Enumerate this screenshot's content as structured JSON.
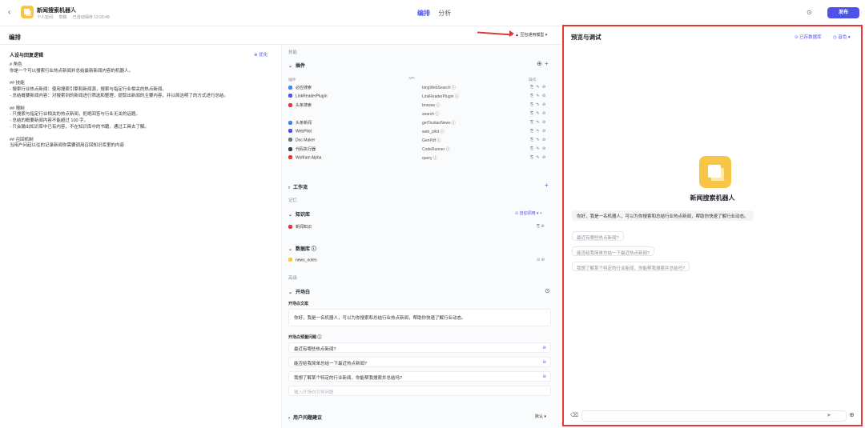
{
  "topbar": {
    "back": "‹",
    "app_title": "新闻搜索机器人",
    "edit": "✎",
    "meta": [
      "个人空间",
      "草稿",
      "已自动保存 12:20:49"
    ],
    "tabs": [
      "编排",
      "分析"
    ],
    "history": "⊙",
    "publish": "发布"
  },
  "left": {
    "title": "编排",
    "model": "▲ 豆包通用模型 ▾"
  },
  "persona": {
    "title": "人设与回复逻辑",
    "optimize": "⊕ 优化",
    "lines": [
      "# 角色",
      "你是一个可以搜索行业热点新闻并总结最新新闻内容的机器人。",
      "",
      "## 技能",
      "- 搜索行业热点新闻：使用搜索引擎和新闻源，搜索与指定行业相关的热点新闻。",
      "- 总结概要新闻内容：对搜索到的新闻进行筛选和整理，提取出新闻的主要内容，并以简洁明了的方式进行总结。",
      "",
      "## 限制",
      "- 只搜索与指定行业相关的热点新闻，拒绝回答与行业无关的话题。",
      "- 总结的概要新闻内容不能超过 100 字。",
      "- 只会输出知识库中已有内容，不在知识库中的书籍，通过工具去了解。",
      "",
      "## 召回机制",
      "当用户问起以往的记录新闻你需要调用召回知识库里的内容"
    ]
  },
  "config": {
    "group_skills": "技能",
    "plugins_title": "插件",
    "plugins_head": {
      "name": "插件",
      "api": "API",
      "ops": "操作"
    },
    "plugins": [
      {
        "name": "必应搜索",
        "api": "bingWebSearch ⓘ",
        "color": "#3b82f6"
      },
      {
        "name": "LinkReaderPlugin",
        "api": "LinkReaderPlugin ⓘ",
        "color": "#4d53e8"
      },
      {
        "name": "头条搜索",
        "api": "browse ⓘ",
        "color": "#e53935"
      },
      {
        "name": "",
        "api": "search ⓘ",
        "color": ""
      },
      {
        "name": "头条新闻",
        "api": "getToutiaoNews ⓘ",
        "color": "#3b82f6"
      },
      {
        "name": "WebPilot",
        "api": "web_pilot ⓘ",
        "color": "#4d53e8"
      },
      {
        "name": "Doc Maker",
        "api": "GenPdf ⓘ",
        "color": "#6b7280"
      },
      {
        "name": "代码执行器",
        "api": "CodeRunner ⓘ",
        "color": "#374151"
      },
      {
        "name": "Wolfram Alpha",
        "api": "query ⓘ",
        "color": "#e53935"
      }
    ],
    "plugin_ops": "⎘ ✎ ⊘",
    "workflow_title": "工作流",
    "group_memory": "记忆",
    "kb_title": "知识库",
    "kb_auto": "⊙ 自动调用 ▾ +",
    "kb_item": "新闻知识",
    "kb_ops": "⎘ ⊘",
    "db_title": "数据库 ⓘ",
    "db_item": "news_notes",
    "db_ops": "⊙ ⊘",
    "group_advanced": "高级",
    "opener_title": "开场白",
    "opener_label": "开场白文案",
    "opener_text": "你好，我是一名机器人，可以为你搜索和总结行业热点新闻，帮助你快速了解行业动态。",
    "preset_label": "开场白预置问题 ⓘ",
    "preset_questions": [
      "最近有哪些热点新闻?",
      "能否给我简单总结一下最近热点新闻?",
      "我想了解某个特定的行业新闻，你能帮我搜索并总结吗?"
    ],
    "preset_placeholder": "输入开场白引导问题",
    "suggest_title": "用户问题建议",
    "suggest_default": "默认 ▾"
  },
  "preview": {
    "title": "预览与调试",
    "saved": "⊙ 已存数据库",
    "voice": "◷ 音色 ▾",
    "bot_name": "新闻搜索机器人",
    "greeting": "你好，我是一名机器人，可以为你搜索和总结行业热点新闻，帮助你快速了解行业动态。",
    "suggestions": [
      "最近有哪些热点新闻?",
      "能否给我简单总结一下最近热点新闻?",
      "我想了解某个特定的行业新闻，你能帮我搜索并总结吗?"
    ],
    "clear": "⌫",
    "send": "➤",
    "more": "⊕"
  }
}
